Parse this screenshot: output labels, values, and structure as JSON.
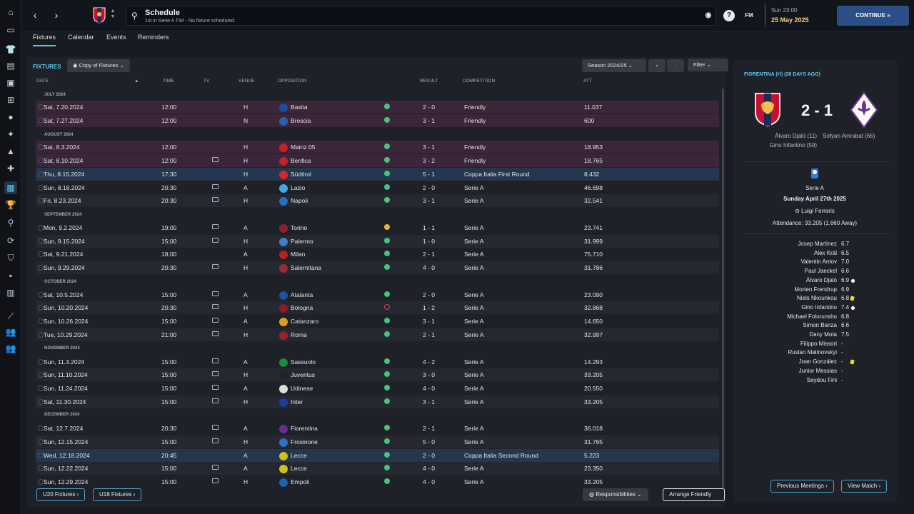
{
  "topbar": {
    "title": "Schedule",
    "subtitle": "1st in Serie A TIM - No fixture scheduled.",
    "fm_label": "FM",
    "help_label": "?",
    "time": "Sun 23:00",
    "date": "25 May 2025",
    "continue_label": "CONTINUE"
  },
  "tabs": [
    {
      "label": "Fixtures"
    },
    {
      "label": "Calendar"
    },
    {
      "label": "Events"
    },
    {
      "label": "Reminders"
    }
  ],
  "fixtures_panel": {
    "title": "FIXTURES",
    "view_dropdown": "Copy of Fixtures",
    "season_dropdown": "Season 2024/25",
    "filter_label": "Filter",
    "headers": [
      "DATE",
      "TIME",
      "TV",
      "VENUE",
      "OPPOSITION",
      "RESULT",
      "COMPETITION",
      "ATT"
    ],
    "months": [
      "JULY 2024",
      "AUGUST 2024",
      "SEPTEMBER 2024",
      "OCTOBER 2024",
      "NOVEMBER 2024",
      "DECEMBER 2024"
    ],
    "rows": [
      {
        "date": "Sat, 7.20.2024",
        "time": "12:00",
        "venue": "H",
        "opp": "Bastia",
        "result": "2 - 0",
        "comp": "Friendly",
        "att": "11.037"
      },
      {
        "date": "Sat, 7.27.2024",
        "time": "12:00",
        "venue": "N",
        "opp": "Brescia",
        "result": "3 - 1",
        "comp": "Friendly",
        "att": "600"
      },
      {
        "date": "Sat, 8.3.2024",
        "time": "12:00",
        "venue": "H",
        "opp": "Mainz 05",
        "result": "3 - 1",
        "comp": "Friendly",
        "att": "18.953"
      },
      {
        "date": "Sat, 8.10.2024",
        "time": "12:00",
        "venue": "H",
        "opp": "Benfica",
        "result": "3 - 2",
        "comp": "Friendly",
        "att": "18.765"
      },
      {
        "date": "Thu, 8.15.2024",
        "time": "17:30",
        "venue": "H",
        "opp": "Südtirol",
        "result": "5 - 1",
        "comp": "Coppa Italia First Round",
        "att": "8.432"
      },
      {
        "date": "Sun, 8.18.2024",
        "time": "20:30",
        "venue": "A",
        "opp": "Lazio",
        "result": "2 - 0",
        "comp": "Serie A",
        "att": "46.698"
      },
      {
        "date": "Fri, 8.23.2024",
        "time": "20:30",
        "venue": "H",
        "opp": "Napoli",
        "result": "3 - 1",
        "comp": "Serie A",
        "att": "32.541"
      },
      {
        "date": "Mon, 9.2.2024",
        "time": "19:00",
        "venue": "A",
        "opp": "Torino",
        "result": "1 - 1",
        "comp": "Serie A",
        "att": "23.741"
      },
      {
        "date": "Sun, 9.15.2024",
        "time": "15:00",
        "venue": "H",
        "opp": "Palermo",
        "result": "1 - 0",
        "comp": "Serie A",
        "att": "31.999"
      },
      {
        "date": "Sat, 9.21.2024",
        "time": "18:00",
        "venue": "A",
        "opp": "Milan",
        "result": "2 - 1",
        "comp": "Serie A",
        "att": "75.710"
      },
      {
        "date": "Sun, 9.29.2024",
        "time": "20:30",
        "venue": "H",
        "opp": "Salernitana",
        "result": "4 - 0",
        "comp": "Serie A",
        "att": "31.786"
      },
      {
        "date": "Sat, 10.5.2024",
        "time": "15:00",
        "venue": "A",
        "opp": "Atalanta",
        "result": "2 - 0",
        "comp": "Serie A",
        "att": "23.090"
      },
      {
        "date": "Sun, 10.20.2024",
        "time": "20:30",
        "venue": "H",
        "opp": "Bologna",
        "result": "1 - 2",
        "comp": "Serie A",
        "att": "32.868"
      },
      {
        "date": "Sun, 10.26.2024",
        "time": "15:00",
        "venue": "A",
        "opp": "Catanzaro",
        "result": "3 - 1",
        "comp": "Serie A",
        "att": "14.650"
      },
      {
        "date": "Tue, 10.29.2024",
        "time": "21:00",
        "venue": "H",
        "opp": "Roma",
        "result": "2 - 1",
        "comp": "Serie A",
        "att": "32.997"
      },
      {
        "date": "Sun, 11.3.2024",
        "time": "15:00",
        "venue": "A",
        "opp": "Sassuolo",
        "result": "4 - 2",
        "comp": "Serie A",
        "att": "14.293"
      },
      {
        "date": "Sun, 11.10.2024",
        "time": "15:00",
        "venue": "H",
        "opp": "Juventus",
        "result": "3 - 0",
        "comp": "Serie A",
        "att": "33.205"
      },
      {
        "date": "Sun, 11.24.2024",
        "time": "15:00",
        "venue": "A",
        "opp": "Udinese",
        "result": "4 - 0",
        "comp": "Serie A",
        "att": "20.550"
      },
      {
        "date": "Sat, 11.30.2024",
        "time": "15:00",
        "venue": "H",
        "opp": "Inter",
        "result": "3 - 1",
        "comp": "Serie A",
        "att": "33.205"
      },
      {
        "date": "Sat, 12.7.2024",
        "time": "20:30",
        "venue": "A",
        "opp": "Fiorentina",
        "result": "2 - 1",
        "comp": "Serie A",
        "att": "36.018"
      },
      {
        "date": "Sun, 12.15.2024",
        "time": "15:00",
        "venue": "H",
        "opp": "Frosinone",
        "result": "5 - 0",
        "comp": "Serie A",
        "att": "31.765"
      },
      {
        "date": "Wed, 12.18.2024",
        "time": "20:45",
        "venue": "A",
        "opp": "Lecce",
        "result": "2 - 0",
        "comp": "Coppa Italia Second Round",
        "att": "5.223"
      },
      {
        "date": "Sun, 12.22.2024",
        "time": "15:00",
        "venue": "A",
        "opp": "Lecce",
        "result": "4 - 0",
        "comp": "Serie A",
        "att": "23.350"
      },
      {
        "date": "Sun, 12.29.2024",
        "time": "15:00",
        "venue": "H",
        "opp": "Empoli",
        "result": "4 - 0",
        "comp": "Serie A",
        "att": "33.205"
      }
    ]
  },
  "bottom": {
    "u20": "U20 Fixtures",
    "u18": "U18 Fixtures",
    "responsibilities": "Responsibilities",
    "arrange": "Arrange Friendly"
  },
  "match_panel": {
    "title": "FIORENTINA (H) (28 DAYS AGO)",
    "score": "2 - 1",
    "home_scorers": "Álvaro Djaló (11)\nGino Infantino (59)",
    "home_scorer_1": "Álvaro Djaló (11)",
    "home_scorer_2": "Gino Infantino (59)",
    "away_scorer": "Sofyan Amrabat (66)",
    "competition": "Serie A",
    "match_date": "Sunday April 27th 2025",
    "stadium": "Luigi Ferraris",
    "attendance": "Attendance: 33.205 (1.660 Away)",
    "players": [
      {
        "name": "Josep Martínez",
        "rating": "6.7"
      },
      {
        "name": "Alex Král",
        "rating": "6.5"
      },
      {
        "name": "Valentin Antov",
        "rating": "7.0"
      },
      {
        "name": "Paul Jaeckel",
        "rating": "6.6"
      },
      {
        "name": "Álvaro Djaló",
        "rating": "6.9"
      },
      {
        "name": "Morten Frendrup",
        "rating": "6.9"
      },
      {
        "name": "Niels Nkounkou",
        "rating": "6.8"
      },
      {
        "name": "Gino Infantino",
        "rating": "7.4"
      },
      {
        "name": "Michael Folorunsho",
        "rating": "6.8"
      },
      {
        "name": "Simon Banza",
        "rating": "6.6"
      },
      {
        "name": "Dany Mota",
        "rating": "7.5"
      },
      {
        "name": "Filippo Missori",
        "rating": "-"
      },
      {
        "name": "Ruslan Malinovskyi",
        "rating": "-"
      },
      {
        "name": "Joan González",
        "rating": "-"
      },
      {
        "name": "Junior Messias",
        "rating": "-"
      },
      {
        "name": "Seydou Fini",
        "rating": "-"
      }
    ],
    "prev_meetings": "Previous Meetings",
    "view_match": "View Match"
  }
}
